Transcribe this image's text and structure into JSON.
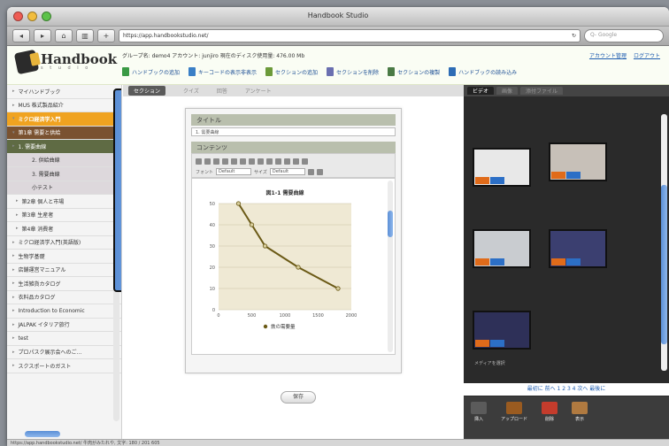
{
  "window": {
    "title": "Handbook Studio"
  },
  "browser": {
    "url": "https://app.handbookstudio.net/",
    "search_placeholder": "Q- Google",
    "nav_back": "◂",
    "nav_forward": "▸",
    "home": "⌂",
    "bookmarks": "▥",
    "add": "+"
  },
  "header": {
    "logo_text": "Handbook",
    "logo_sub": "s t u d i o",
    "info": "グループ名: demo4 アカウント: junjiro 現在のディスク使用量: 476.00 Mb",
    "links": [
      "アカウント管理",
      "ログアウト"
    ],
    "actions": [
      {
        "label": "ハンドブックの追加",
        "color": "#3a9a45"
      },
      {
        "label": "キーコードの表示非表示",
        "color": "#3a7fc6"
      },
      {
        "label": "セクションの追加",
        "color": "#6c9a3a"
      },
      {
        "label": "セクションを削除",
        "color": "#6a6fb0"
      },
      {
        "label": "セクションの複製",
        "color": "#4a7a45"
      },
      {
        "label": "ハンドブックの読み込み",
        "color": "#2d6cb5"
      }
    ]
  },
  "sidebar": {
    "items": [
      {
        "label": "マイハンドブック",
        "type": "normal"
      },
      {
        "label": "MUS 株式製品紹介",
        "type": "normal"
      },
      {
        "label": "ミクロ経済学入門",
        "type": "hl"
      },
      {
        "label": "第1章 需要と供給",
        "type": "dk"
      },
      {
        "label": "1. 需要曲線",
        "type": "sel"
      },
      {
        "label": "2. 供給曲線",
        "type": "gy"
      },
      {
        "label": "3. 需要曲線",
        "type": "gy"
      },
      {
        "label": "小テスト",
        "type": "gy"
      },
      {
        "label": "第2章 個人と市場",
        "type": "ch"
      },
      {
        "label": "第3章 生産者",
        "type": "ch"
      },
      {
        "label": "第4章 消費者",
        "type": "ch"
      },
      {
        "label": "ミクロ経済学入門(英語版)",
        "type": "normal"
      },
      {
        "label": "生物学基礎",
        "type": "normal"
      },
      {
        "label": "店舗運営マニュアル",
        "type": "normal"
      },
      {
        "label": "生活雑貨カタログ",
        "type": "normal"
      },
      {
        "label": "衣料品カタログ",
        "type": "normal"
      },
      {
        "label": "Introduction to Economic",
        "type": "normal"
      },
      {
        "label": "JALPAK イタリア旅行",
        "type": "normal"
      },
      {
        "label": "test",
        "type": "normal"
      },
      {
        "label": "プロパスク展示会へのご…",
        "type": "normal"
      },
      {
        "label": "スクスポートのガスト",
        "type": "normal"
      }
    ]
  },
  "center": {
    "tabs": [
      "セクション",
      "クイズ",
      "回答",
      "アンケート"
    ],
    "title_label": "タイトル",
    "title_value": "1. 需要曲線",
    "content_label": "コンテンツ",
    "font_label": "フォント",
    "font_value": "Default",
    "size_label": "サイズ",
    "size_value": "Default",
    "save": "保存"
  },
  "chart_data": {
    "type": "line",
    "title": "図1-1 需要曲線",
    "x": [
      300,
      500,
      700,
      1200,
      1800
    ],
    "y": [
      50,
      40,
      30,
      20,
      10
    ],
    "xlim": [
      0,
      2000
    ],
    "ylim": [
      0,
      50
    ],
    "xticks": [
      "0",
      "500",
      "1000",
      "1500",
      "2000"
    ],
    "yticks": [
      "0",
      "10",
      "20",
      "30",
      "40",
      "50"
    ],
    "series_name": "鉄の需要量",
    "grid": true,
    "legend": "bottom",
    "line_color": "#6b5a16",
    "bg_color": "#efe9d4"
  },
  "right": {
    "tabs": [
      "ビデオ",
      "画像",
      "添付ファイル"
    ],
    "media_caption": "メディアを選択",
    "pager": "最初に 前へ 1 2 3 4 次へ 最後に",
    "buttons": [
      {
        "label": "挿入",
        "color": "#5b5b5b"
      },
      {
        "label": "アップロード",
        "color": "#9a5b20"
      },
      {
        "label": "削除",
        "color": "#c43c2c"
      },
      {
        "label": "表示",
        "color": "#b07a40"
      }
    ]
  },
  "status": "https://app.handbookstudio.net/ 牛肉がみたれや, 文字: 180 / 201 605"
}
